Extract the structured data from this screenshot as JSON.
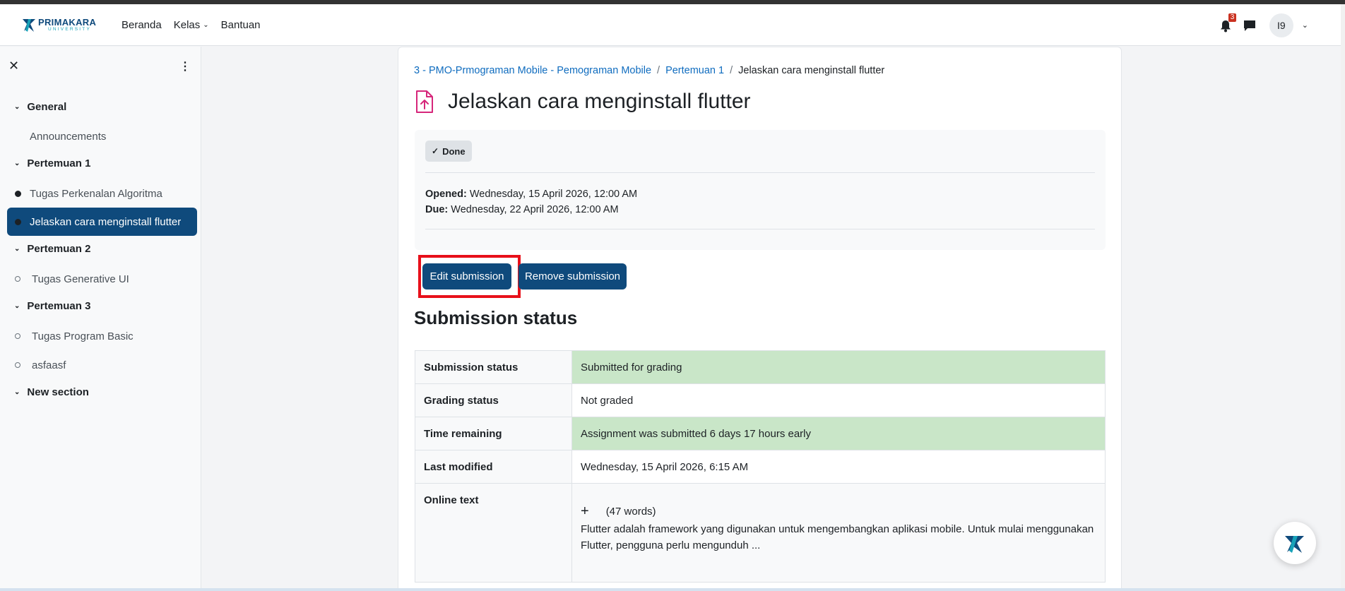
{
  "header": {
    "logo_text": "PRIMAKARA",
    "logo_subtext": "UNIVERSITY",
    "nav": [
      {
        "label": "Beranda"
      },
      {
        "label": "Kelas"
      },
      {
        "label": "Bantuan"
      }
    ],
    "notification_count": "3",
    "user_initials": "I9"
  },
  "sidebar": {
    "sections": [
      {
        "title": "General",
        "items": [
          {
            "label": "Announcements",
            "marker": "none"
          }
        ]
      },
      {
        "title": "Pertemuan 1",
        "items": [
          {
            "label": "Tugas Perkenalan Algoritma",
            "marker": "filled"
          },
          {
            "label": "Jelaskan cara menginstall flutter",
            "marker": "filled",
            "active": true
          }
        ]
      },
      {
        "title": "Pertemuan 2",
        "items": [
          {
            "label": "Tugas Generative UI",
            "marker": "empty"
          }
        ]
      },
      {
        "title": "Pertemuan 3",
        "items": [
          {
            "label": "Tugas Program Basic",
            "marker": "empty"
          },
          {
            "label": "asfaasf",
            "marker": "empty"
          }
        ]
      },
      {
        "title": "New section",
        "items": []
      }
    ]
  },
  "breadcrumb": {
    "course": "3 - PMO-Prmograman Mobile - Pemograman Mobile",
    "section": "Pertemuan 1",
    "current": "Jelaskan cara menginstall flutter"
  },
  "page": {
    "title": "Jelaskan cara menginstall flutter",
    "done_label": "Done",
    "opened_label": "Opened:",
    "opened_value": "Wednesday, 15 April 2026, 12:00 AM",
    "due_label": "Due:",
    "due_value": "Wednesday, 22 April 2026, 12:00 AM",
    "edit_button": "Edit submission",
    "remove_button": "Remove submission",
    "section_title": "Submission status"
  },
  "submission_table": {
    "rows": [
      {
        "label": "Submission status",
        "value": "Submitted for grading",
        "status_color": "#c9e6c8"
      },
      {
        "label": "Grading status",
        "value": "Not graded"
      },
      {
        "label": "Time remaining",
        "value": "Assignment was submitted 6 days 17 hours early",
        "status_color": "#c9e6c8"
      },
      {
        "label": "Last modified",
        "value": "Wednesday, 15 April 2026, 6:15 AM"
      }
    ],
    "online_text": {
      "label": "Online text",
      "expand_symbol": "+",
      "word_count": "(47 words)",
      "preview": "Flutter adalah framework yang digunakan untuk mengembangkan aplikasi mobile. Untuk mulai menggunakan Flutter, pengguna perlu mengunduh ..."
    }
  },
  "colors": {
    "brand": "#0f4a7c",
    "link": "#0f6cbf",
    "success_bg": "#c9e6c8",
    "highlight": "#e8101a",
    "assign_icon": "#d6267a"
  }
}
